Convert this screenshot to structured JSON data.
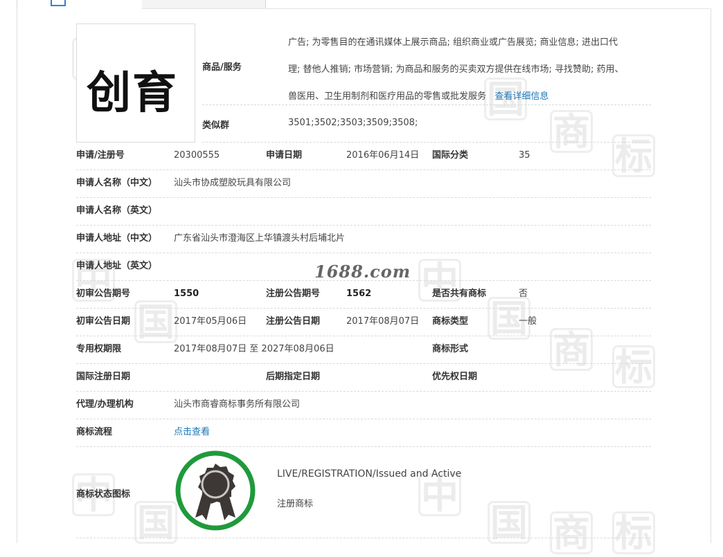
{
  "watermark_chars": [
    "中",
    "国",
    "商",
    "标"
  ],
  "site_mark": "1688.com",
  "logo": {
    "text": "创育"
  },
  "goods_services": {
    "label": "商品/服务",
    "lines": [
      "广告; 为零售目的在通讯媒体上展示商品; 组织商业或广告展览; 商业信息; 进出口代",
      "理; 替他人推销; 市场营销; 为商品和服务的买卖双方提供在线市场; 寻找赞助; 药用、",
      "兽医用、卫生用制剂和医疗用品的零售或批发服务"
    ],
    "detail_link": "查看详细信息"
  },
  "similar_group": {
    "label": "类似群",
    "value": "3501;3502;3503;3509;3508;"
  },
  "rows": {
    "reg_no": {
      "label": "申请/注册号",
      "value": "20300555"
    },
    "apply_date": {
      "label": "申请日期",
      "value": "2016年06月14日"
    },
    "intl_class": {
      "label": "国际分类",
      "value": "35"
    },
    "applicant_cn": {
      "label": "申请人名称（中文）",
      "value": "汕头市协成塑胶玩具有限公司"
    },
    "applicant_en": {
      "label": "申请人名称（英文）",
      "value": ""
    },
    "address_cn": {
      "label": "申请人地址（中文）",
      "value": "广东省汕头市澄海区上华镇渡头村后埔北片"
    },
    "address_en": {
      "label": "申请人地址（英文）",
      "value": ""
    },
    "prelim_pub_no": {
      "label": "初审公告期号",
      "value": "1550"
    },
    "reg_pub_no": {
      "label": "注册公告期号",
      "value": "1562"
    },
    "shared": {
      "label": "是否共有商标",
      "value": "否"
    },
    "prelim_pub_date": {
      "label": "初审公告日期",
      "value": "2017年05月06日"
    },
    "reg_pub_date": {
      "label": "注册公告日期",
      "value": "2017年08月07日"
    },
    "tm_type": {
      "label": "商标类型",
      "value": "一般"
    },
    "exclusive_period": {
      "label": "专用权期限",
      "value": "2017年08月07日 至 2027年08月06日"
    },
    "tm_form": {
      "label": "商标形式",
      "value": ""
    },
    "intl_reg_date": {
      "label": "国际注册日期",
      "value": ""
    },
    "later_designation": {
      "label": "后期指定日期",
      "value": ""
    },
    "priority_date": {
      "label": "优先权日期",
      "value": ""
    },
    "agency": {
      "label": "代理/办理机构",
      "value": "汕头市商睿商标事务所有限公司"
    },
    "flow": {
      "label": "商标流程",
      "value": "点击查看"
    },
    "status_icon": {
      "label": "商标状态图标",
      "status_en": "LIVE/REGISTRATION/Issued and Active",
      "status_cn": "注册商标"
    }
  },
  "colors": {
    "link": "#1a76b8",
    "seal_ring": "#1f9a3b",
    "seal_body": "#3d3835"
  }
}
